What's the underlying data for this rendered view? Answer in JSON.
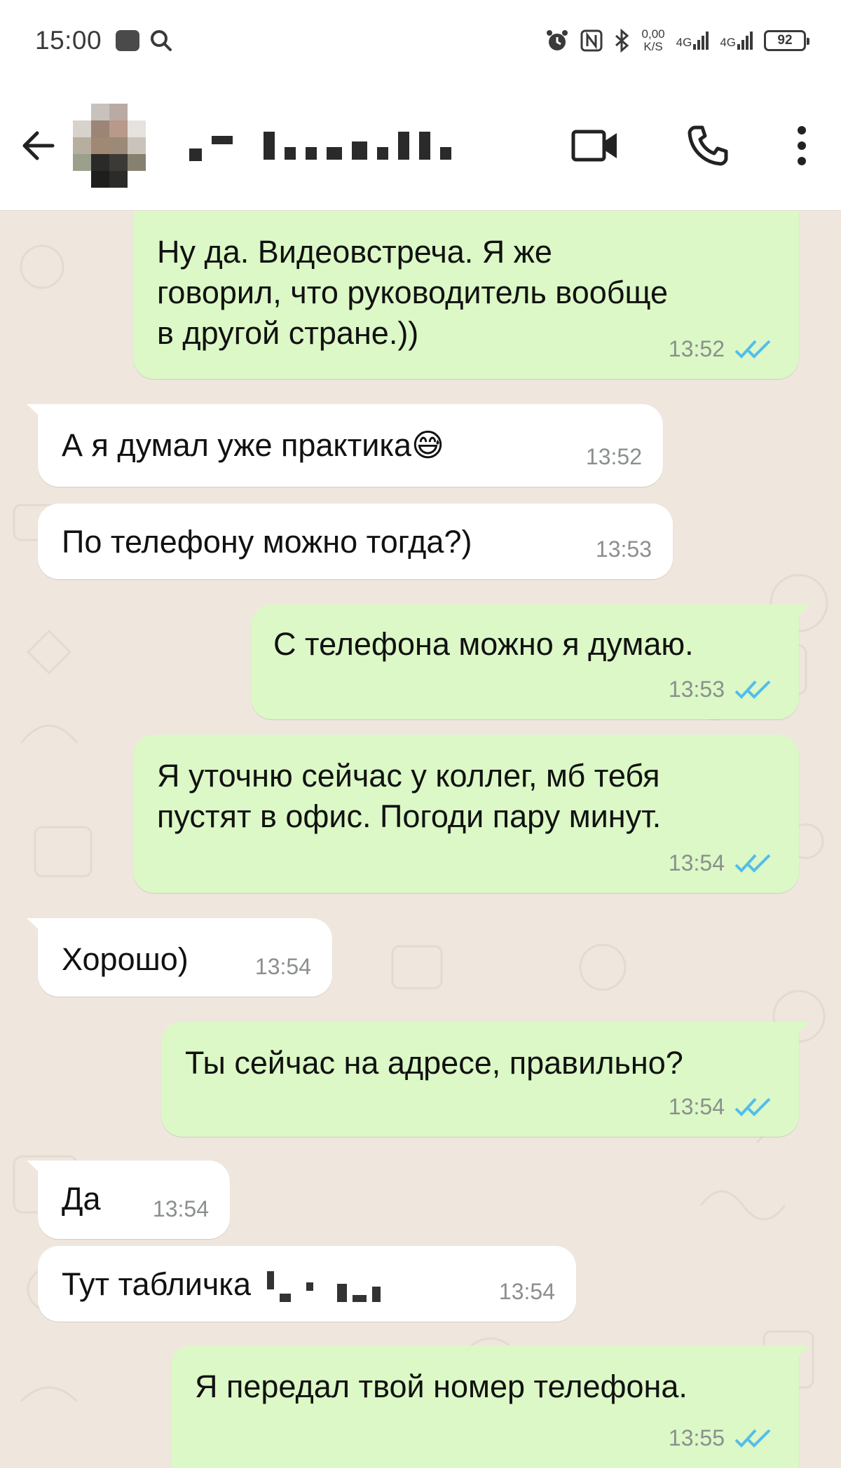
{
  "status_bar": {
    "time": "15:00",
    "search_icon": "search-icon",
    "net_speed_value": "0,00",
    "net_speed_unit": "K/S",
    "sim1": "4G",
    "sim2": "4G",
    "battery": "92"
  },
  "header": {
    "back_icon": "arrow-left-icon",
    "contact_name": "",
    "video_icon": "video-call-icon",
    "call_icon": "phone-icon",
    "menu_icon": "more-vertical-icon"
  },
  "colors": {
    "outgoing": "#dbf8c6",
    "incoming": "#ffffff",
    "wallpaper": "#efe7de",
    "read_ticks": "#53bdeb"
  },
  "messages": [
    {
      "dir": "out",
      "lines": [
        "Ну да. Видеовстреча. Я же",
        "говорил, что руководитель вообще",
        "в другой стране.))"
      ],
      "time": "13:52"
    },
    {
      "dir": "in",
      "lines": [
        "А я думал уже практика😅"
      ],
      "time": "13:52"
    },
    {
      "dir": "in",
      "lines": [
        "По телефону можно тогда?)"
      ],
      "time": "13:53"
    },
    {
      "dir": "out",
      "lines": [
        "С телефона можно я думаю."
      ],
      "time": "13:53"
    },
    {
      "dir": "out",
      "lines": [
        "Я уточню сейчас у коллег, мб тебя",
        "пустят в офис. Погоди пару минут."
      ],
      "time": "13:54"
    },
    {
      "dir": "in",
      "lines": [
        "Хорошо)"
      ],
      "time": "13:54"
    },
    {
      "dir": "out",
      "lines": [
        "Ты сейчас на адресе, правильно?"
      ],
      "time": "13:54"
    },
    {
      "dir": "in",
      "lines": [
        "Да"
      ],
      "time": "13:54"
    },
    {
      "dir": "in",
      "lines": [
        "Тут табличка"
      ],
      "time": "13:54"
    },
    {
      "dir": "out",
      "lines": [
        "Я передал твой номер телефона."
      ],
      "time": "13:55"
    }
  ]
}
